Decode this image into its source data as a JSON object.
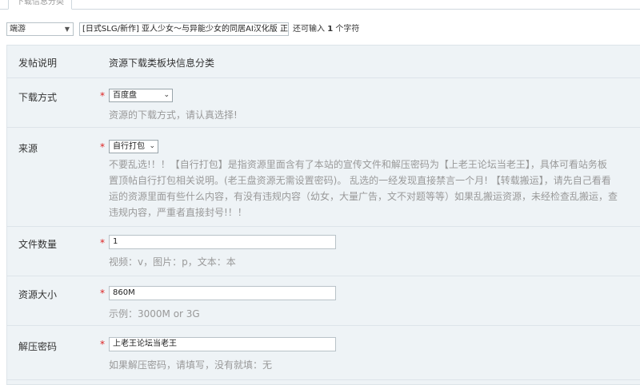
{
  "tab": {
    "label": "下载信息分类"
  },
  "top": {
    "category": "端游",
    "title": "[日式SLG/新作] 亚人少女～与异能少女的同居AI汉化版 正",
    "remain_prefix": "还可输入",
    "remain_count": "1",
    "remain_suffix": "个字符"
  },
  "form": {
    "info": {
      "label": "发帖说明",
      "value": "资源下载类板块信息分类"
    },
    "download": {
      "label": "下载方式",
      "star": "*",
      "selected": "百度盘",
      "hint": "资源的下载方式，请认真选择!"
    },
    "source": {
      "label": "来源",
      "star": "*",
      "selected": "自行打包",
      "hint_lines": [
        "不要乱选!！！【自行打包】是指资源里面含有了本站的宣传文件和解压密码为【上老王论坛当老王】，具体可看站务板",
        "置顶帖自行打包相关说明。(老王盘资源无需设置密码)。 乱选的一经发现直接禁言一个月! 【转载搬运】，请先自己看看",
        "运的资源里面有些什么内容，有没有违规内容（幼女，大量广告，文不对题等等）如果乱搬运资源，未经检查乱搬运，查",
        "违规内容，严重者直接封号!！！"
      ]
    },
    "file_count": {
      "label": "文件数量",
      "star": "*",
      "value": "1",
      "hint": "视频：v，图片：p，文本：本"
    },
    "size": {
      "label": "资源大小",
      "star": "*",
      "value": "860M",
      "hint": "示例：3000M or 3G"
    },
    "password": {
      "label": "解压密码",
      "star": "*",
      "value": "上老王论坛当老王",
      "hint": "如果解压密码，请填写，没有就填：无"
    }
  }
}
